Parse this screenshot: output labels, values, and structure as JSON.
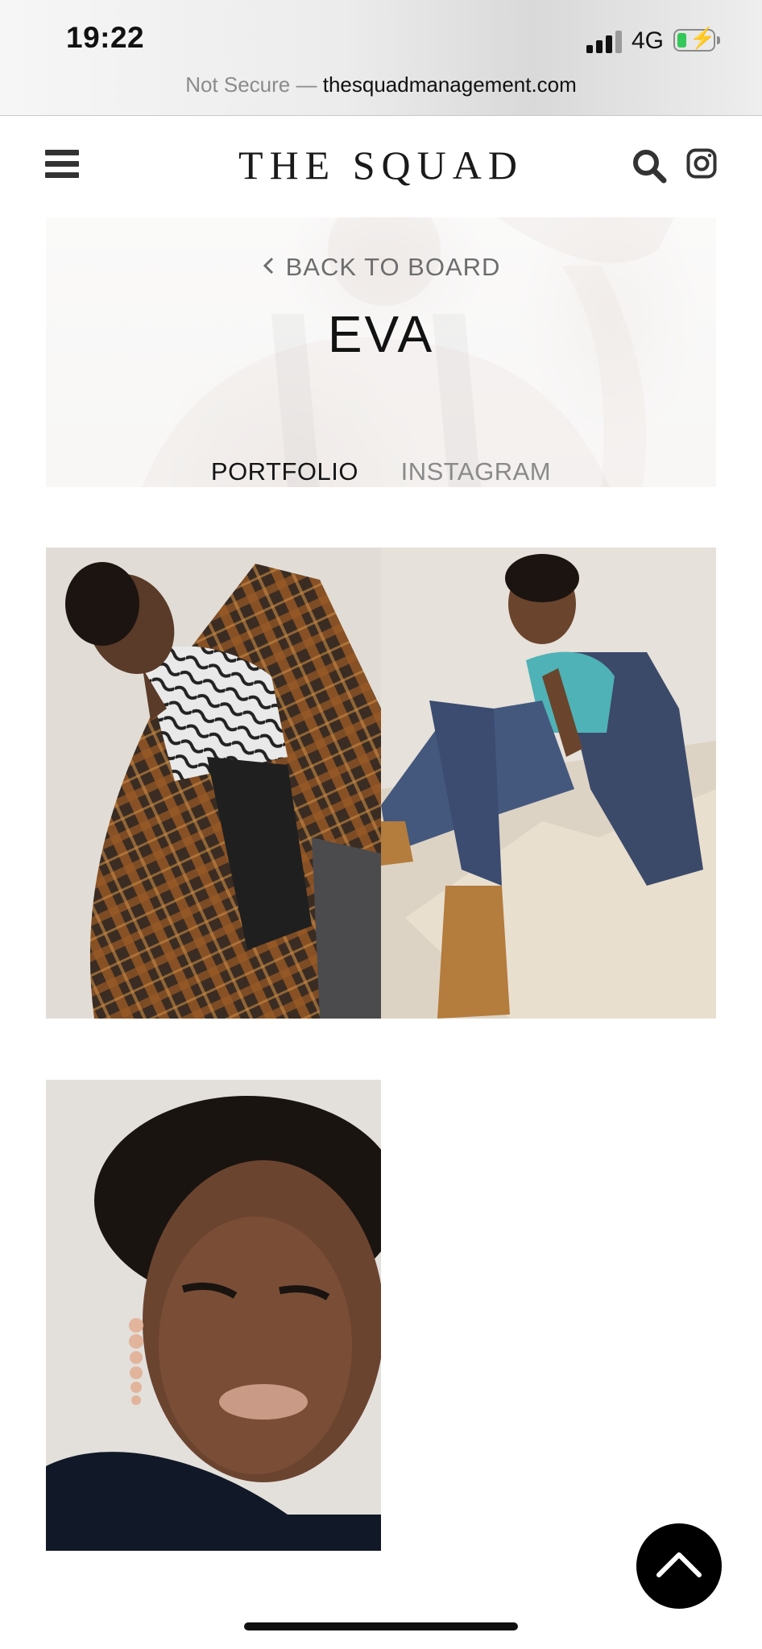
{
  "status_bar": {
    "time": "19:22",
    "network": "4G",
    "signal_bars": 3,
    "battery_level": 0.25,
    "battery_color": "#34c759"
  },
  "url_bar": {
    "security": "Not Secure",
    "separator": " — ",
    "domain": "thesquadmanagement.com"
  },
  "header": {
    "logo": "THE SQUAD",
    "menu_icon": "hamburger-menu-icon",
    "search_icon": "search-icon",
    "social_icon": "instagram-icon"
  },
  "hero": {
    "back_label": "BACK TO BOARD",
    "back_icon": "chevron-left-icon",
    "model_name": "EVA",
    "tabs": [
      {
        "label": "PORTFOLIO",
        "active": true
      },
      {
        "label": "INSTAGRAM",
        "active": false
      }
    ]
  },
  "gallery": {
    "photos": [
      {
        "description": "model in plaid shirt and tie-dye top"
      },
      {
        "description": "model seated in denim with boots"
      },
      {
        "description": "model close-up portrait with heart earrings"
      }
    ]
  },
  "scroll_top": {
    "icon": "chevron-up-icon"
  },
  "colors": {
    "accent": "#000000",
    "text": "#121212",
    "muted": "#8a8a8a"
  }
}
